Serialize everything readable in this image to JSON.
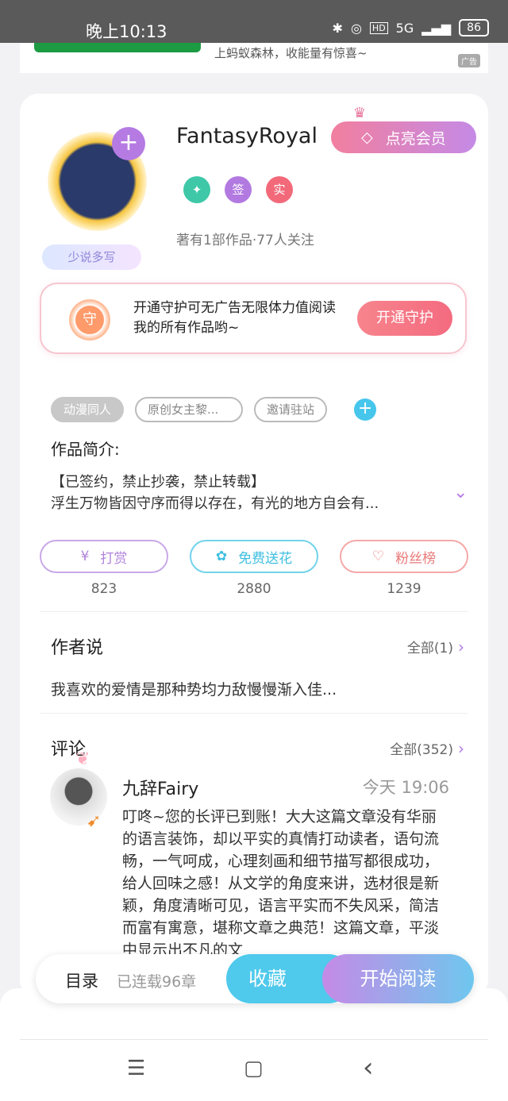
{
  "statusbar": {
    "time": "晚上10:13",
    "network": "5G",
    "battery": "86"
  },
  "ad": {
    "text": "上蚂蚁森林，收能量有惊喜~",
    "badge": "广告"
  },
  "profile": {
    "avatar_plus": "+",
    "signature_tag": "少说多写",
    "username": "FantasyRoyal",
    "vip_button": "点亮会员",
    "badges": [
      "签",
      "实"
    ],
    "works_info": "著有1部作品·77人关注"
  },
  "guard": {
    "icon_text": "守",
    "text": "开通守护可无广告无限体力值阅读我的所有作品哟~",
    "button": "开通守护"
  },
  "tags": {
    "items": [
      "动漫同人",
      "原创女主黎...",
      "邀请驻站"
    ],
    "add": "+"
  },
  "intro": {
    "title": "作品简介:",
    "line1": "【已签约，禁止抄袭，禁止转载】",
    "line2": "浮生万物皆因守序而得以存在，有光的地方自会有..."
  },
  "actions": [
    {
      "icon": "¥",
      "label": "打赏",
      "count": "823"
    },
    {
      "icon": "✿",
      "label": "免费送花",
      "count": "2880"
    },
    {
      "icon": "♡",
      "label": "粉丝榜",
      "count": "1239"
    }
  ],
  "author_say": {
    "title": "作者说",
    "more": "全部(1)",
    "text": "我喜欢的爱情是那种势均力敌慢慢渐入佳..."
  },
  "comments": {
    "title": "评论",
    "more": "全部(352)",
    "first": {
      "name": "九辞Fairy",
      "time": "今天 19:06",
      "body": "叮咚~您的长评已到账！大大这篇文章没有华丽的语言装饰，却以平实的真情打动读者，语句流畅，一气呵成，心理刻画和细节描写都很成功，给人回味之感！从文学的角度来讲，选材很是新颖，角度清晰可见，语言平实而不失风采，简洁而富有寓意，堪称文章之典范！这篇文章，平淡中显示出不凡的文"
    }
  },
  "bottombar": {
    "toc": "目录",
    "serial": "已连载96章",
    "favorite": "收藏",
    "read": "开始阅读"
  },
  "navbar": {
    "menu": "☰",
    "home": "▢",
    "back": "‹"
  }
}
